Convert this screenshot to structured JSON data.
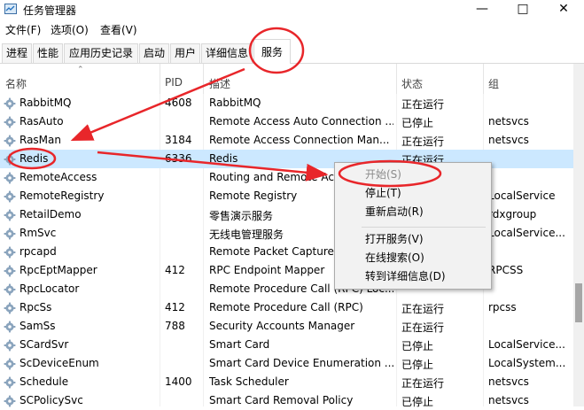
{
  "window": {
    "title": "任务管理器",
    "minimize_icon": "minimize-icon",
    "maximize_icon": "maximize-icon",
    "close_icon": "close-icon"
  },
  "menu": [
    "文件(F)",
    "选项(O)",
    "查看(V)"
  ],
  "tabs": [
    {
      "label": "进程",
      "active": false
    },
    {
      "label": "性能",
      "active": false
    },
    {
      "label": "应用历史记录",
      "active": false
    },
    {
      "label": "启动",
      "active": false
    },
    {
      "label": "用户",
      "active": false
    },
    {
      "label": "详细信息",
      "active": false
    },
    {
      "label": "服务",
      "active": true
    }
  ],
  "columns": {
    "name": "名称",
    "pid": "PID",
    "desc": "描述",
    "status": "状态",
    "group": "组"
  },
  "rows": [
    {
      "name": "RabbitMQ",
      "pid": "4608",
      "desc": "RabbitMQ",
      "status": "正在运行",
      "group": ""
    },
    {
      "name": "RasAuto",
      "pid": "",
      "desc": "Remote Access Auto Connection ...",
      "status": "已停止",
      "group": "netsvcs"
    },
    {
      "name": "RasMan",
      "pid": "3184",
      "desc": "Remote Access Connection Man...",
      "status": "正在运行",
      "group": "netsvcs"
    },
    {
      "name": "Redis",
      "pid": "6336",
      "desc": "Redis",
      "status": "正在运行",
      "group": ""
    },
    {
      "name": "RemoteAccess",
      "pid": "",
      "desc": "Routing and Remote Acc",
      "status": "",
      "group": ""
    },
    {
      "name": "RemoteRegistry",
      "pid": "",
      "desc": "Remote Registry",
      "status": "",
      "group": "LocalService"
    },
    {
      "name": "RetailDemo",
      "pid": "",
      "desc": "零售演示服务",
      "status": "",
      "group": "rdxgroup"
    },
    {
      "name": "RmSvc",
      "pid": "",
      "desc": "无线电管理服务",
      "status": "",
      "group": "LocalService..."
    },
    {
      "name": "rpcapd",
      "pid": "",
      "desc": "Remote Packet Capture",
      "status": "",
      "group": ""
    },
    {
      "name": "RpcEptMapper",
      "pid": "412",
      "desc": "RPC Endpoint Mapper",
      "status": "",
      "group": "RPCSS"
    },
    {
      "name": "RpcLocator",
      "pid": "",
      "desc": "Remote Procedure Call (RPC) Loc...",
      "status": "",
      "group": ""
    },
    {
      "name": "RpcSs",
      "pid": "412",
      "desc": "Remote Procedure Call (RPC)",
      "status": "正在运行",
      "group": "rpcss"
    },
    {
      "name": "SamSs",
      "pid": "788",
      "desc": "Security Accounts Manager",
      "status": "正在运行",
      "group": ""
    },
    {
      "name": "SCardSvr",
      "pid": "",
      "desc": "Smart Card",
      "status": "已停止",
      "group": "LocalService..."
    },
    {
      "name": "ScDeviceEnum",
      "pid": "",
      "desc": "Smart Card Device Enumeration ...",
      "status": "已停止",
      "group": "LocalSystem..."
    },
    {
      "name": "Schedule",
      "pid": "1400",
      "desc": "Task Scheduler",
      "status": "正在运行",
      "group": "netsvcs"
    },
    {
      "name": "SCPolicySvc",
      "pid": "",
      "desc": "Smart Card Removal Policy",
      "status": "已停止",
      "group": "netsvcs"
    }
  ],
  "selected_row": "Redis",
  "context_menu": {
    "start": "开始(S)",
    "stop": "停止(T)",
    "restart": "重新启动(R)",
    "open_services": "打开服务(V)",
    "search_online": "在线搜索(O)",
    "go_to_details": "转到详细信息(D)"
  },
  "colors": {
    "selection": "#cce8ff",
    "annotation": "#e8262a"
  }
}
